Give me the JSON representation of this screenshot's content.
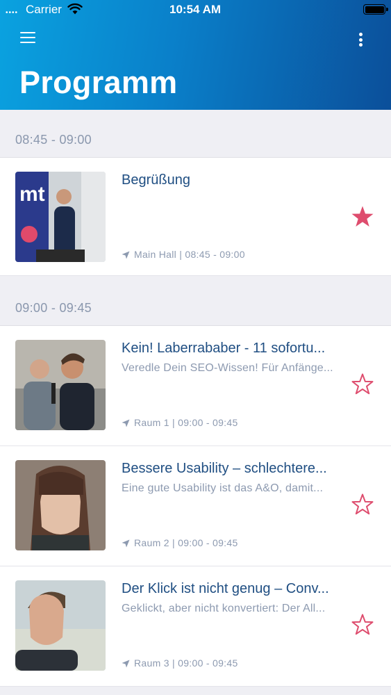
{
  "status_bar": {
    "carrier": "Carrier",
    "time": "10:54 AM"
  },
  "header": {
    "title": "Programm",
    "menu_icon": "hamburger-menu-icon",
    "more_icon": "more-vertical-icon",
    "gradient_colors": [
      "#0aa2e0",
      "#0b4f9a"
    ]
  },
  "schedule": {
    "sections": [
      {
        "time": "08:45 - 09:00",
        "sessions": [
          {
            "title": "Begrüßung",
            "subtitle": "",
            "meta": "Main Hall | 08:45 - 09:00",
            "favorite": true
          }
        ]
      },
      {
        "time": "09:00 - 09:45",
        "sessions": [
          {
            "title": "Kein! Laberrababer - 11 sofortu...",
            "subtitle": "Veredle Dein SEO-Wissen! Für Anfänge...",
            "meta": "Raum 1 | 09:00 - 09:45",
            "favorite": false
          },
          {
            "title": "Bessere Usability – schlechtere...",
            "subtitle": "Eine gute Usability ist das A&O, damit...",
            "meta": "Raum 2 | 09:00 - 09:45",
            "favorite": false
          },
          {
            "title": "Der Klick ist nicht genug – Conv...",
            "subtitle": "Geklickt, aber nicht konvertiert: Der All...",
            "meta": "Raum 3 | 09:00 - 09:45",
            "favorite": false
          }
        ]
      }
    ]
  },
  "colors": {
    "accent_star": "#de4d6e",
    "title_text": "#1f4e82",
    "secondary_text": "#8d9ab0"
  }
}
